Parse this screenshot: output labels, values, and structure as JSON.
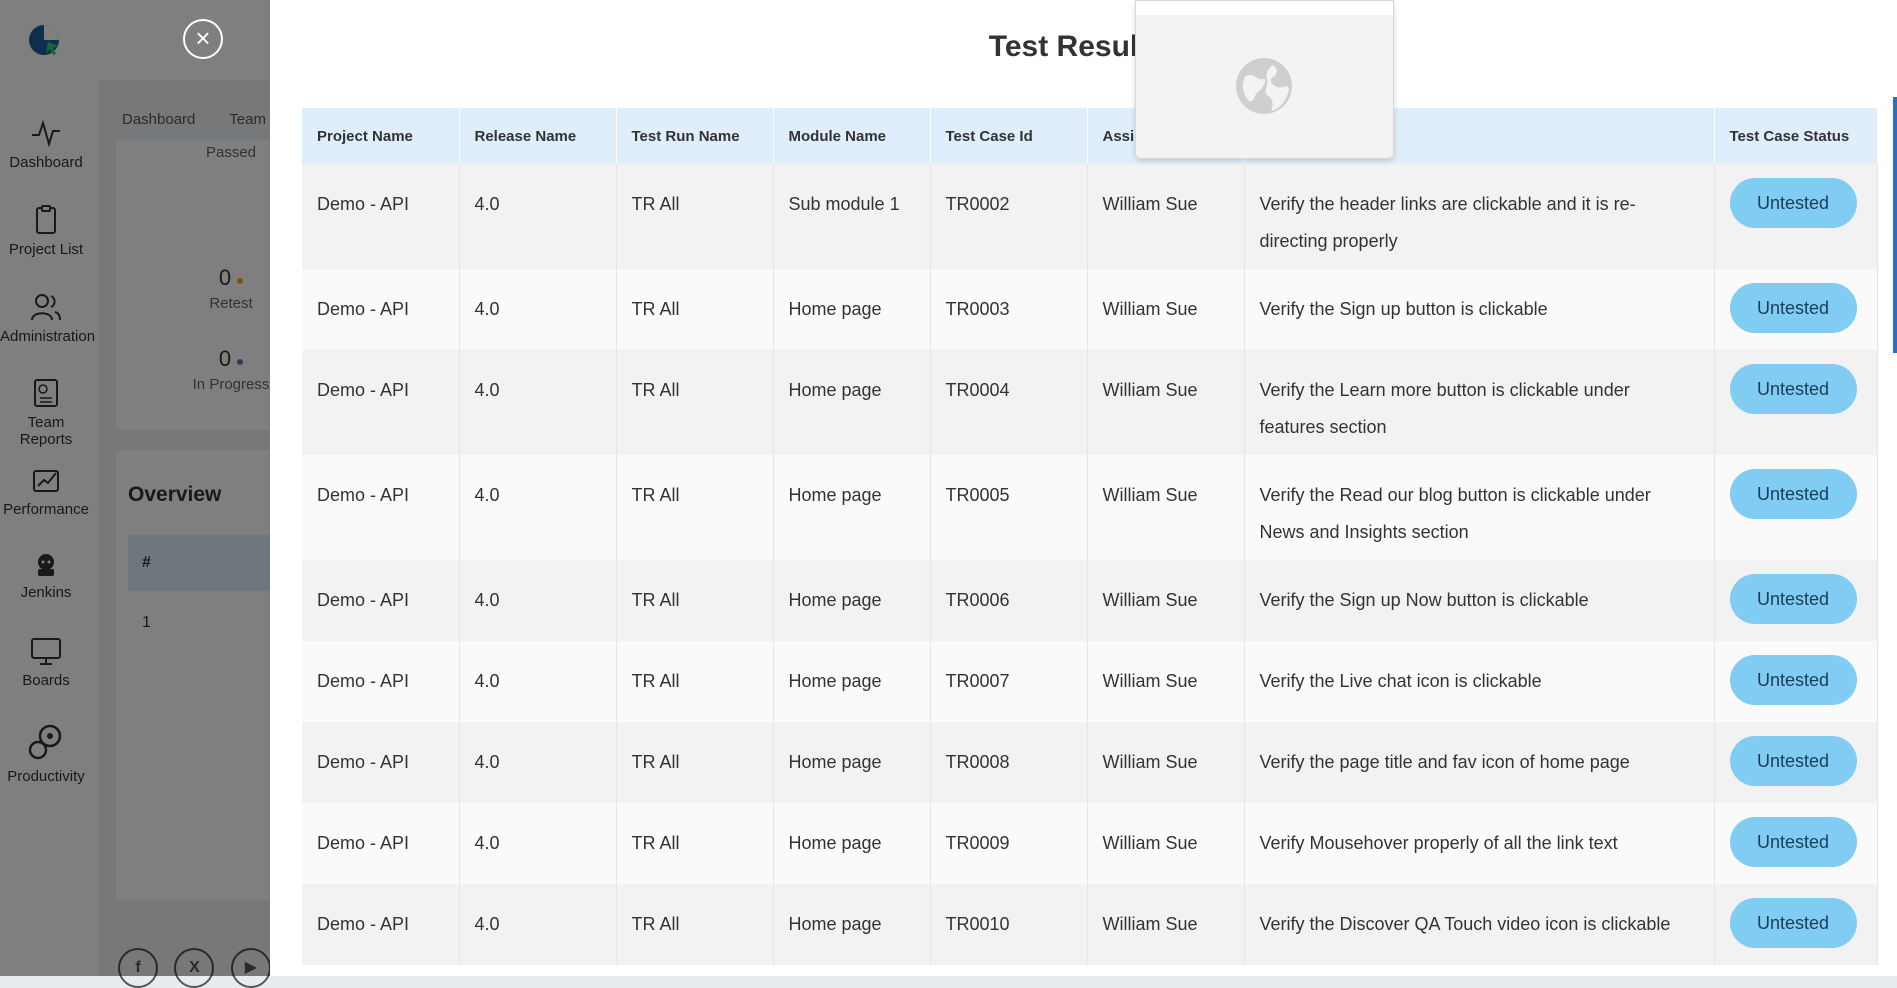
{
  "sidebar": {
    "items": [
      {
        "label": "Dashboard",
        "icon": "activity-icon"
      },
      {
        "label": "Project List",
        "icon": "clipboard-icon"
      },
      {
        "label": "Administration",
        "icon": "users-icon"
      },
      {
        "label": "Team Reports",
        "icon": "report-icon"
      },
      {
        "label": "Performance",
        "icon": "performance-icon"
      },
      {
        "label": "Jenkins",
        "icon": "jenkins-icon"
      },
      {
        "label": "Boards",
        "icon": "board-icon"
      },
      {
        "label": "Productivity",
        "icon": "productivity-icon"
      }
    ]
  },
  "breadcrumbs": [
    "Dashboard",
    "Team"
  ],
  "stats": [
    {
      "label": "Passed"
    },
    {
      "value": "0",
      "label": "Retest",
      "color": "#f0b400"
    },
    {
      "value": "0",
      "label": "In Progress",
      "color": "#9b59b6"
    }
  ],
  "overview": {
    "title": "Overview",
    "header": "#",
    "rows": [
      "1"
    ]
  },
  "modal": {
    "title": "Test Result D",
    "close_icon": "close-icon",
    "columns": [
      "Project Name",
      "Release Name",
      "Test Run Name",
      "Module Name",
      "Test Case Id",
      "Assi",
      "",
      "Test Case Status"
    ],
    "rows": [
      {
        "project": "Demo - API",
        "release": "4.0",
        "run": "TR All",
        "module": "Sub module 1",
        "id": "TR0002",
        "assignee": "William Sue",
        "title": "Verify the header links are clickable and it is re-directing properly",
        "status": "Untested"
      },
      {
        "project": "Demo - API",
        "release": "4.0",
        "run": "TR All",
        "module": "Home page",
        "id": "TR0003",
        "assignee": "William Sue",
        "title": "Verify the Sign up button is clickable",
        "status": "Untested"
      },
      {
        "project": "Demo - API",
        "release": "4.0",
        "run": "TR All",
        "module": "Home page",
        "id": "TR0004",
        "assignee": "William Sue",
        "title": "Verify the Learn more button is clickable under features section",
        "status": "Untested"
      },
      {
        "project": "Demo - API",
        "release": "4.0",
        "run": "TR All",
        "module": "Home page",
        "id": "TR0005",
        "assignee": "William Sue",
        "title": "Verify the Read our blog button is clickable under News and Insights section",
        "status": "Untested"
      },
      {
        "project": "Demo - API",
        "release": "4.0",
        "run": "TR All",
        "module": "Home page",
        "id": "TR0006",
        "assignee": "William Sue",
        "title": "Verify the Sign up Now button is clickable",
        "status": "Untested"
      },
      {
        "project": "Demo - API",
        "release": "4.0",
        "run": "TR All",
        "module": "Home page",
        "id": "TR0007",
        "assignee": "William Sue",
        "title": "Verify the Live chat icon is clickable",
        "status": "Untested"
      },
      {
        "project": "Demo - API",
        "release": "4.0",
        "run": "TR All",
        "module": "Home page",
        "id": "TR0008",
        "assignee": "William Sue",
        "title": "Verify the page title and fav icon of home page",
        "status": "Untested"
      },
      {
        "project": "Demo - API",
        "release": "4.0",
        "run": "TR All",
        "module": "Home page",
        "id": "TR0009",
        "assignee": "William Sue",
        "title": "Verify Mousehover properly of all the link text",
        "status": "Untested"
      },
      {
        "project": "Demo - API",
        "release": "4.0",
        "run": "TR All",
        "module": "Home page",
        "id": "TR0010",
        "assignee": "William Sue",
        "title": "Verify the Discover QA Touch video icon is clickable",
        "status": "Untested"
      }
    ]
  },
  "colors": {
    "header_bg": "#dfeefa",
    "pill_bg": "#81ccf2",
    "overlay": "rgba(0,0,0,0.5)",
    "accent": "#2f6fbf"
  }
}
